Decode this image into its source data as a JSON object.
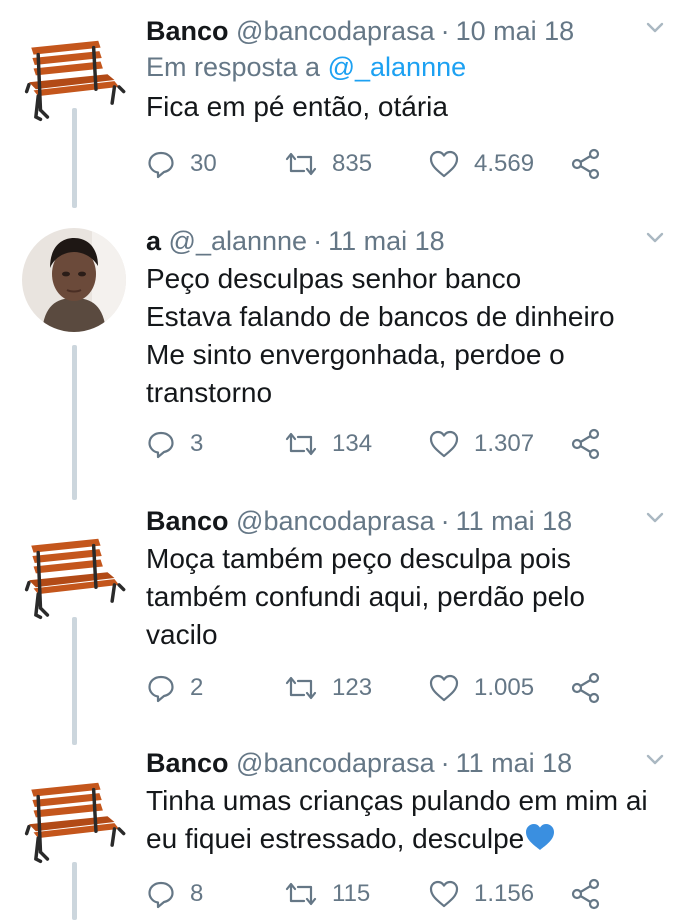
{
  "tweets": [
    {
      "name": "Banco",
      "handle": "@bancodaprasa",
      "date": "10 mai 18",
      "reply_prefix": "Em resposta a",
      "reply_handle": "@_alannne",
      "lines": [
        "Fica em pé então, otária"
      ],
      "replies": "30",
      "retweets": "835",
      "likes": "4.569",
      "avatar": "bench-icon"
    },
    {
      "name": "a",
      "handle": "@_alannne",
      "date": "11 mai 18",
      "lines": [
        "Peço desculpas senhor banco",
        "Estava falando de bancos de dinheiro",
        "Me sinto envergonhada, perdoe o",
        "transtorno"
      ],
      "replies": "3",
      "retweets": "134",
      "likes": "1.307",
      "avatar": "user-photo"
    },
    {
      "name": "Banco",
      "handle": "@bancodaprasa",
      "date": "11 mai 18",
      "lines": [
        "Moça também peço desculpa pois",
        "também confundi aqui, perdão pelo",
        "vacilo"
      ],
      "replies": "2",
      "retweets": "123",
      "likes": "1.005",
      "avatar": "bench-icon"
    },
    {
      "name": "Banco",
      "handle": "@bancodaprasa",
      "date": "11 mai 18",
      "lines": [
        "Tinha umas crianças pulando em mim ai",
        "eu fiquei estressado, desculpe"
      ],
      "replies": "8",
      "retweets": "115",
      "likes": "1.156",
      "avatar": "bench-icon",
      "trailing_emoji": "blue-heart-icon"
    }
  ],
  "colors": {
    "accent": "#1da1f2",
    "muted": "#657786",
    "thread_line": "#ccd6dd",
    "bench_wood": "#c4561c",
    "heart_blue": "#3a8fe0"
  }
}
